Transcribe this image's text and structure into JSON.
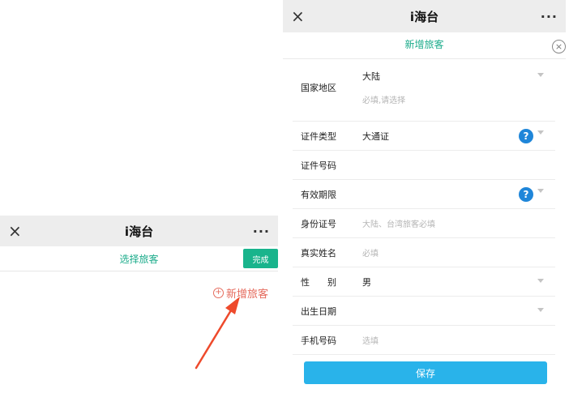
{
  "left_screen": {
    "nav": {
      "close": "×",
      "title": "i海台",
      "more": "···"
    },
    "subtitle": "选择旅客",
    "done_label": "完成",
    "add_traveler_icon": "⊕",
    "add_traveler_label": "新增旅客",
    "colors": {
      "accent": "#1aab8a",
      "done_button": "#19b48c",
      "add_link": "#e56b5d",
      "arrow": "#ee4a2c"
    }
  },
  "right_screen": {
    "nav": {
      "close": "×",
      "title": "i海台",
      "more": "···"
    },
    "subtitle": "新增旅客",
    "close_icon": "×",
    "form": {
      "country": {
        "label": "国家地区",
        "value": "大陆",
        "hint": "必填,请选择"
      },
      "id_type": {
        "label": "证件类型",
        "value": "大通证"
      },
      "id_number": {
        "label": "证件号码"
      },
      "validity": {
        "label": "有效期限"
      },
      "id_card": {
        "label": "身份证号",
        "placeholder": "大陆、台湾旅客必填"
      },
      "real_name": {
        "label": "真实姓名",
        "placeholder": "必填"
      },
      "gender": {
        "label": "性　　别",
        "value": "男"
      },
      "birthday": {
        "label": "出生日期"
      },
      "phone": {
        "label": "手机号码",
        "placeholder": "选填"
      }
    },
    "help_icon": "?",
    "save_label": "保存",
    "colors": {
      "accent": "#1aab8a",
      "help_icon": "#1f86d9",
      "save_button": "#29b3ea"
    }
  }
}
